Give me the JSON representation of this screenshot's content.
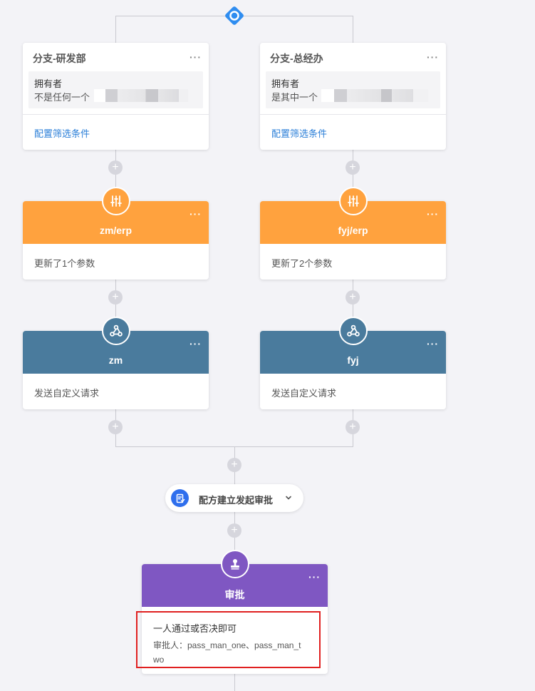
{
  "colors": {
    "condition_accent": "#2f8df0",
    "orange": "#ffa23e",
    "steel": "#4a7b9d",
    "purple": "#7f57c2",
    "link": "#2b7fd8",
    "highlight_border": "#e02020",
    "pill_icon": "#2f6fed"
  },
  "top_node": {
    "icon": "condition-diamond-icon"
  },
  "branches": [
    {
      "condition": {
        "title": "分支-研发部",
        "more": "···",
        "field_label": "拥有者",
        "operator": "不是任何一个",
        "link": "配置筛选条件"
      },
      "param_node": {
        "title": "zm/erp",
        "more": "···",
        "body": "更新了1个参数",
        "icon": "sliders-icon"
      },
      "request_node": {
        "title": "zm",
        "more": "···",
        "body": "发送自定义请求",
        "icon": "webhook-icon"
      }
    },
    {
      "condition": {
        "title": "分支-总经办",
        "more": "···",
        "field_label": "拥有者",
        "operator": "是其中一个",
        "link": "配置筛选条件"
      },
      "param_node": {
        "title": "fyj/erp",
        "more": "···",
        "body": "更新了2个参数",
        "icon": "sliders-icon"
      },
      "request_node": {
        "title": "fyj",
        "more": "···",
        "body": "发送自定义请求",
        "icon": "webhook-icon"
      }
    }
  ],
  "trigger_pill": {
    "label": "配方建立发起审批",
    "icon": "form-document-icon",
    "chevron": "chevron-down-icon"
  },
  "approval_node": {
    "title": "审批",
    "more": "···",
    "rule": "一人通过或否决即可",
    "approvers_line1": "审批人：pass_man_one、pass_man_t",
    "approvers_line2": "wo",
    "icon": "stamp-icon"
  },
  "plus_symbol": "+"
}
